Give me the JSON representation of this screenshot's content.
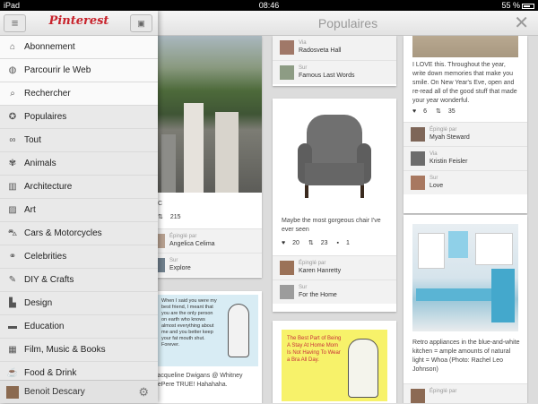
{
  "status_bar": {
    "device": "iPad",
    "time": "08:46",
    "battery": "55 %"
  },
  "header": {
    "title": "Populaires",
    "close_icon": "close-icon"
  },
  "sidebar": {
    "logo": "Pinterest",
    "top_items": [
      {
        "label": "Abonnement",
        "icon": "home-icon"
      },
      {
        "label": "Parcourir le Web",
        "icon": "globe-icon"
      },
      {
        "label": "Rechercher",
        "icon": "search-icon"
      }
    ],
    "categories": [
      {
        "label": "Populaires",
        "icon": "ribbon-icon"
      },
      {
        "label": "Tout",
        "icon": "infinity-icon"
      },
      {
        "label": "Animals",
        "icon": "lion-icon"
      },
      {
        "label": "Architecture",
        "icon": "building-icon"
      },
      {
        "label": "Art",
        "icon": "picture-icon"
      },
      {
        "label": "Cars & Motorcycles",
        "icon": "car-icon"
      },
      {
        "label": "Celebrities",
        "icon": "glasses-icon"
      },
      {
        "label": "DIY & Crafts",
        "icon": "brush-icon"
      },
      {
        "label": "Design",
        "icon": "ruler-icon"
      },
      {
        "label": "Education",
        "icon": "book-icon"
      },
      {
        "label": "Film, Music & Books",
        "icon": "film-icon"
      },
      {
        "label": "Food & Drink",
        "icon": "cup-icon"
      }
    ],
    "user": {
      "name": "Benoit Descary"
    }
  },
  "pins": {
    "central_park": {
      "desc": "C",
      "likes": "",
      "repins": "215",
      "pinned_by_label": "Épinglé par",
      "pinned_by": "Angelica Celima",
      "board_label": "Sur",
      "board": "Explore"
    },
    "ecard_left": {
      "text": "When I said you were my best friend, I meant that you are the only person on earth who knows almost everything about me and you better keep your fat mouth shut. Forever.",
      "desc": "Jacqueline Dwigans @ Whitney LePere TRUE! Hahahaha."
    },
    "top_mid": {
      "via_label": "Via",
      "via": "Radosveta Hall",
      "board_label": "Sur",
      "board": "Famous Last Words"
    },
    "chair": {
      "desc": "Maybe the most gorgeous chair I've ever seen",
      "likes": "20",
      "repins": "23",
      "comments": "1",
      "pinned_by_label": "Épinglé par",
      "pinned_by": "Karen Hanretty",
      "board_label": "Sur",
      "board": "For the Home"
    },
    "ecard_mid": {
      "text": "The Best Part of Being A Stay At Home Mom Is Not Having To Wear a Bra All Day."
    },
    "jar": {
      "desc": "I LOVE this. Throughout the year, write down memories that make you smile. On New Year's Eve, open and re-read all of the good stuff that made your year wonderful.",
      "likes": "6",
      "repins": "35",
      "pinned_by_label": "Épinglé par",
      "pinned_by": "Myah Steward",
      "via_label": "Via",
      "via": "Kristin Feisler",
      "board_label": "Sur",
      "board": "Love"
    },
    "kitchen": {
      "desc": "Retro appliances in the blue-and-white kitchen = ample amounts of natural light = Whoa (Photo: Rachel Leo Johnson)",
      "pinned_by_label": "Épinglé par"
    }
  }
}
